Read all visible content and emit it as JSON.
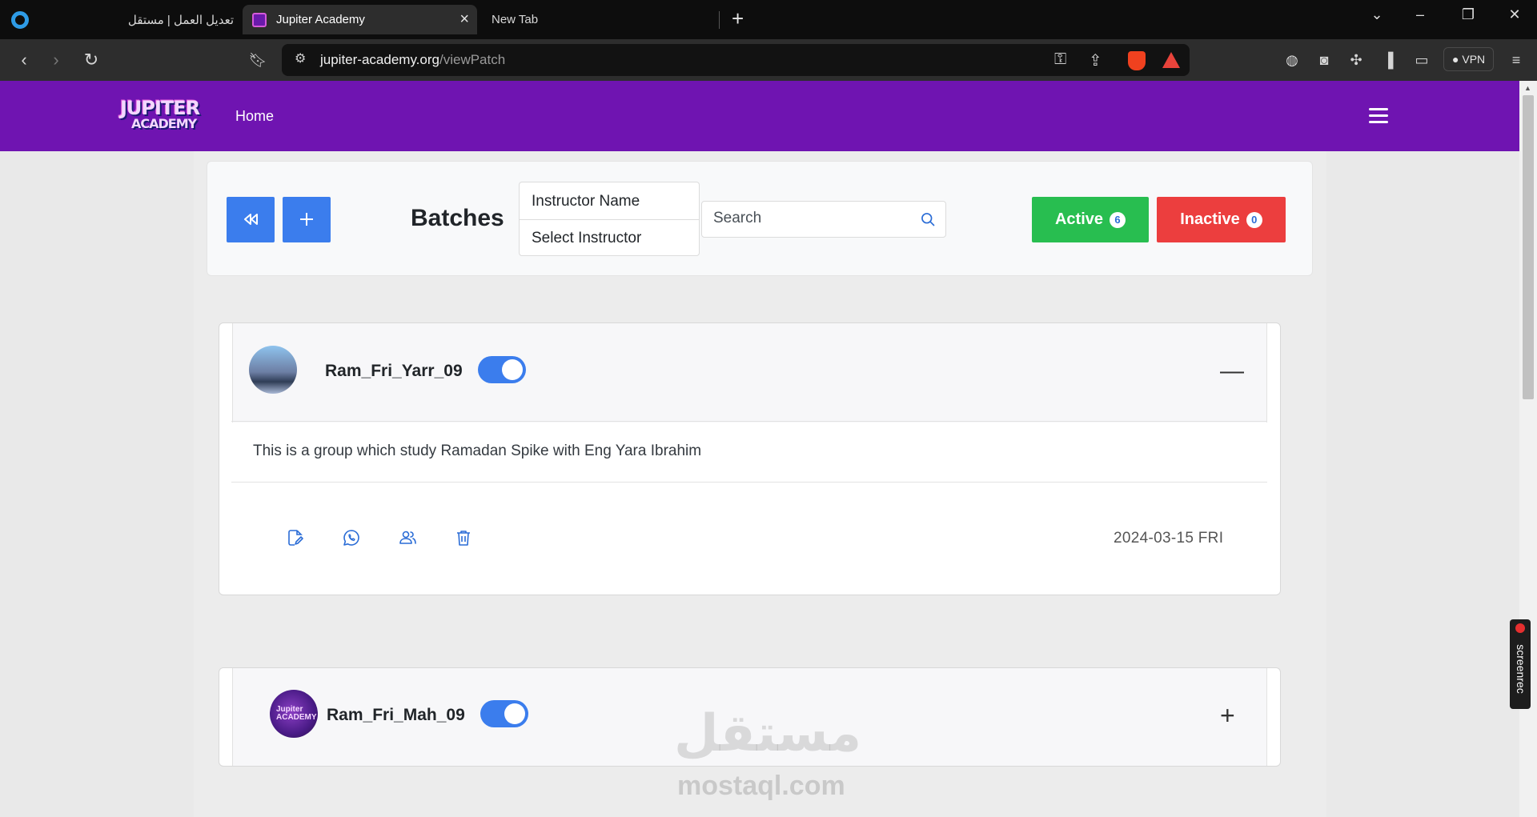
{
  "browser": {
    "tabs": [
      {
        "title": "تعديل العمل | مستقل"
      },
      {
        "title": "Jupiter Academy"
      },
      {
        "title": "New Tab"
      }
    ],
    "url_host": "jupiter-academy.org",
    "url_path": "/viewPatch",
    "vpn_label": "VPN"
  },
  "navbar": {
    "logo_line1": "JUPITER",
    "logo_line2": "ACADEMY",
    "home_label": "Home"
  },
  "header": {
    "title": "Batches",
    "instructor_label": "Instructor Name",
    "instructor_select": "Select Instructor",
    "search_placeholder": "Search",
    "active_label": "Active",
    "active_count": "6",
    "inactive_label": "Inactive",
    "inactive_count": "0"
  },
  "batches": [
    {
      "name": "Ram_Fri_Yarr_09",
      "description": "This is a group which study Ramadan Spike with Eng Yara Ibrahim",
      "date": "2024-03-15 FRI",
      "expanded": true,
      "active": true
    },
    {
      "name": "Ram_Fri_Mah_09",
      "avatar_text": "Jupiter ACADEMY",
      "expanded": false,
      "active": true
    }
  ],
  "watermark": {
    "arabic": "مستقل",
    "latin": "mostaql.com"
  },
  "screenrec_label": "screenrec",
  "colors": {
    "brand_purple": "#6f14b1",
    "primary_blue": "#3b7ded",
    "active_green": "#28be50",
    "inactive_red": "#ec3e3e"
  }
}
